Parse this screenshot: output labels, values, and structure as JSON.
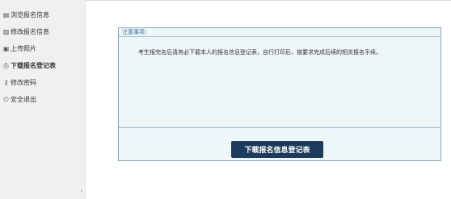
{
  "sidebar": {
    "items": [
      {
        "icon": "grid-icon",
        "glyph": "▤",
        "label": "浏览报名信息"
      },
      {
        "icon": "edit-icon",
        "glyph": "▨",
        "label": "修改报名信息"
      },
      {
        "icon": "image-icon",
        "glyph": "▣",
        "label": "上传照片"
      },
      {
        "icon": "print-icon",
        "glyph": "⎙",
        "label": "下载报名登记表"
      },
      {
        "icon": "key-icon",
        "glyph": "⚷",
        "label": "修改密码"
      },
      {
        "icon": "power-icon",
        "glyph": "⏻",
        "label": "安全退出"
      }
    ],
    "collapse_glyph": "‹"
  },
  "notice": {
    "title": "注意事项:",
    "body": "考生报完名后请务必下载本人的报名信息登记表，自行打印后，按要求完成后续的相关报名手续。",
    "download_label": "下载报名信息登记表"
  },
  "colors": {
    "accent": "#1d3b5c",
    "notice_bg": "#eef6f7",
    "notice_border": "#7fa6c2",
    "title_text": "#2d6aa3",
    "sidebar_bg": "#f0f0f0"
  }
}
